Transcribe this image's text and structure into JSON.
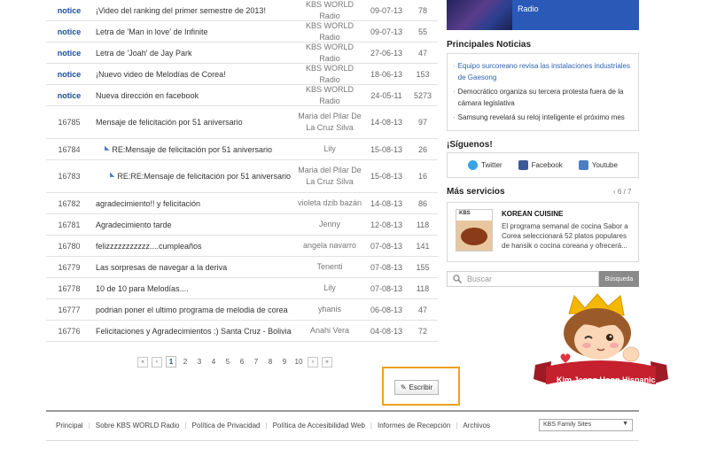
{
  "board": {
    "rows": [
      {
        "no": "notice",
        "title": "¡Video del ranking del primer semestre de 2013!",
        "author": "KBS WORLD Radio",
        "date": "09-07-13",
        "views": "78",
        "notice": true
      },
      {
        "no": "notice",
        "title": "Letra de 'Man in love' de Infinite",
        "author": "KBS WORLD Radio",
        "date": "09-07-13",
        "views": "55",
        "notice": true
      },
      {
        "no": "notice",
        "title": "Letra de 'Joah' de Jay Park",
        "author": "KBS WORLD Radio",
        "date": "27-06-13",
        "views": "47",
        "notice": true
      },
      {
        "no": "notice",
        "title": "¡Nuevo video de Melodías de Corea!",
        "author": "KBS WORLD Radio",
        "date": "18-06-13",
        "views": "153",
        "notice": true
      },
      {
        "no": "notice",
        "title": "Nueva dirección en facebook",
        "author": "KBS WORLD Radio",
        "date": "24-05-11",
        "views": "5273",
        "notice": true
      },
      {
        "no": "16785",
        "title": "Mensaje de felicitación por 51 aniversario",
        "author": "Maria del Pilar De La Cruz Silva",
        "date": "14-08-13",
        "views": "97",
        "tall": true
      },
      {
        "no": "16784",
        "title": "RE:Mensaje de felicitación por 51 aniversario",
        "author": "Lily",
        "date": "15-08-13",
        "views": "26",
        "reply": 1
      },
      {
        "no": "16783",
        "title": "RE:RE:Mensaje de felicitación por 51 aniversario",
        "author": "Maria del Pilar De La Cruz Silva",
        "date": "15-08-13",
        "views": "16",
        "reply": 2,
        "tall": true
      },
      {
        "no": "16782",
        "title": "agradecimiento!! y felicitación",
        "author": "violeta dzib bazán",
        "date": "14-08-13",
        "views": "86"
      },
      {
        "no": "16781",
        "title": "Agradecimiento tarde",
        "author": "Jenny",
        "date": "12-08-13",
        "views": "118"
      },
      {
        "no": "16780",
        "title": "felizzzzzzzzzzz....cumpleaños",
        "author": "angela navarro",
        "date": "07-08-13",
        "views": "141"
      },
      {
        "no": "16779",
        "title": "Las sorpresas de navegar a la deriva",
        "author": "Tenenti",
        "date": "07-08-13",
        "views": "155"
      },
      {
        "no": "16778",
        "title": "10 de 10 para Melodías....",
        "author": "Lily",
        "date": "07-08-13",
        "views": "118"
      },
      {
        "no": "16777",
        "title": "podrian poner el ultimo programa de melodia de corea",
        "author": "yhanis",
        "date": "06-08-13",
        "views": "47"
      },
      {
        "no": "16776",
        "title": "Felicitaciones y Agradecimientos :) Santa Cruz - Bolivia",
        "author": "Anahi Vera",
        "date": "04-08-13",
        "views": "72"
      }
    ]
  },
  "pager": {
    "first": "«",
    "prev": "‹",
    "pages": [
      "1",
      "2",
      "3",
      "4",
      "5",
      "6",
      "7",
      "8",
      "9",
      "10"
    ],
    "current": "1",
    "next": "›",
    "last": "»"
  },
  "write_label": "Escribir",
  "footer": {
    "links": [
      "Principal",
      "Sobre KBS WORLD Radio",
      "Política de Privacidad",
      "Política de Accesibilidad Web",
      "Informes de Recepción",
      "Archivos"
    ],
    "family_select": "KBS Family Sites"
  },
  "sidebar": {
    "radio_label": "Radio",
    "news_heading": "Principales Noticias",
    "news": [
      "Equipo surcoreano revisa las instalaciones industriales de Gaesong",
      "Democrático organiza su tercera protesta fuera de la cámara legislativa",
      "Samsung revelará su reloj inteligente el próximo mes"
    ],
    "follow_heading": "¡Síguenos!",
    "social": [
      "Twitter",
      "Facebook",
      "Youtube"
    ],
    "more_heading": "Más servicios",
    "more_pager": "6 / 7",
    "cuisine_title": "KOREAN CUISINE",
    "cuisine_desc": "El programa semanal de cocina Sabor a Corea seleccionará 52 platos populares de hansik o cocina coreana y ofrecerá...",
    "cuisine_img_label": "KBS",
    "search_placeholder": "Buscar",
    "search_button": "Búsqueda"
  },
  "mascot_label": "Kim Jeong Hoon Hispanic",
  "colors": {
    "accent": "#1c4f9c",
    "radio_bg": "#2a59b7",
    "highlight": "#f0a020",
    "ribbon": "#c4202e"
  }
}
